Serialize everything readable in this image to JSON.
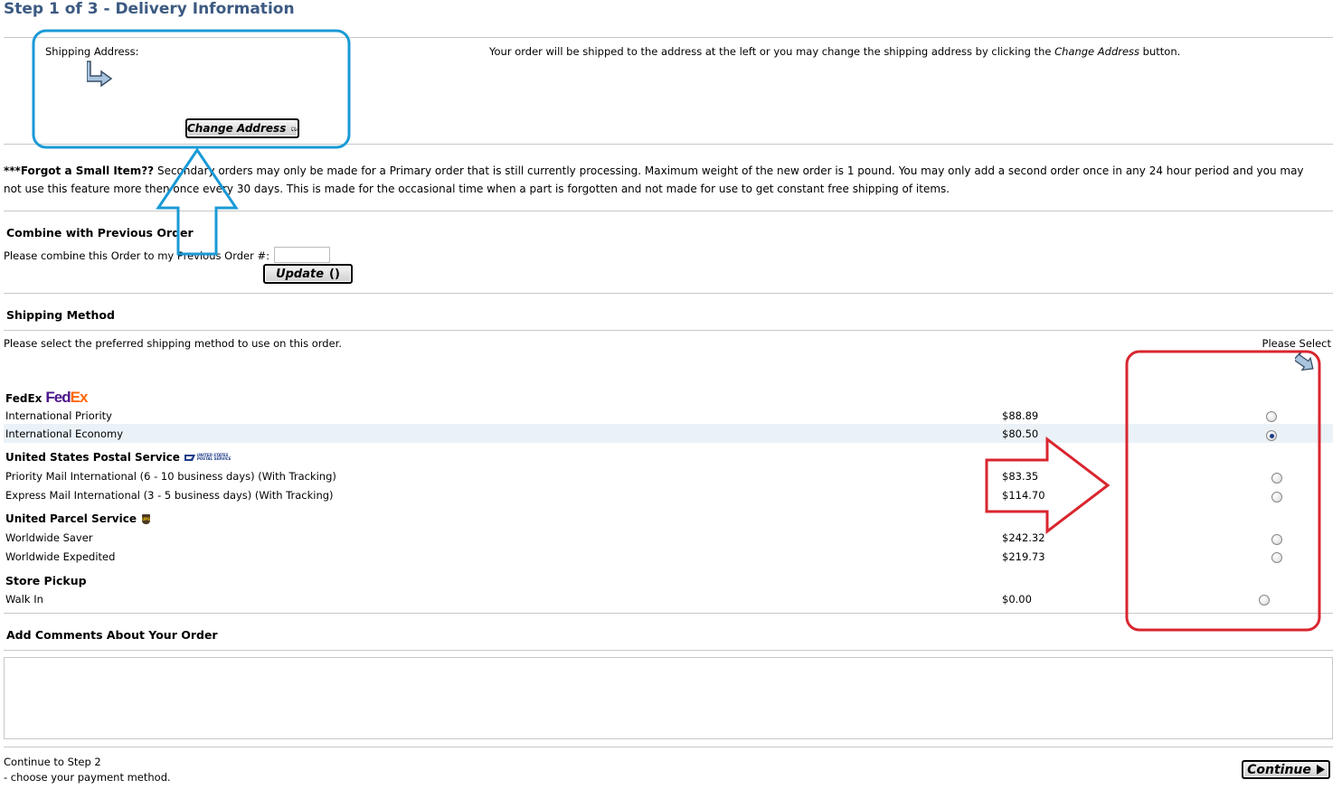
{
  "page": {
    "title": "Step 1 of 3 - Delivery Information"
  },
  "address": {
    "label": "Shipping Address:",
    "change_button": "Change Address",
    "info_pre": "Your order will be shipped to the address at the left or you may change the shipping address by clicking the ",
    "info_em": "Change Address",
    "info_post": " button."
  },
  "notice": {
    "bold": "***Forgot a Small Item??",
    "text": " Secondary orders may only be made for a Primary order that is still currently processing. Maximum weight of the new order is 1 pound. You may only add a second order once in any 24 hour period and you may not use this feature more then once every 30 days. This is made for the occasional time when a part is forgotten and not made for use to get constant free shipping of items."
  },
  "combine": {
    "heading": "Combine with Previous Order",
    "label": "Please combine this Order to my Previous Order #:",
    "input_value": "",
    "update_button": "Update"
  },
  "shipping": {
    "heading": "Shipping Method",
    "instruction": "Please select the preferred shipping method to use on this order.",
    "please_select": "Please Select",
    "carriers": [
      {
        "name": "FedEx",
        "logo_fe": "Fed",
        "logo_ex": "Ex",
        "options": [
          {
            "label": "International Priority",
            "price": "$88.89",
            "selected": false
          },
          {
            "label": "International Economy",
            "price": "$80.50",
            "selected": true
          }
        ]
      },
      {
        "name": "United States Postal Service",
        "logo_text": "UNITED STATES POSTAL SERVICE",
        "options": [
          {
            "label": "Priority Mail International (6 - 10 business days) (With Tracking)",
            "price": "$83.35",
            "selected": false
          },
          {
            "label": "Express Mail International (3 - 5 business days) (With Tracking)",
            "price": "$114.70",
            "selected": false
          }
        ]
      },
      {
        "name": "United Parcel Service",
        "logo_text": "UPS",
        "options": [
          {
            "label": "Worldwide Saver",
            "price": "$242.32",
            "selected": false
          },
          {
            "label": "Worldwide Expedited",
            "price": "$219.73",
            "selected": false
          }
        ]
      },
      {
        "name": "Store Pickup",
        "options": [
          {
            "label": "Walk In",
            "price": "$0.00",
            "selected": false
          }
        ]
      }
    ]
  },
  "comments": {
    "heading": "Add Comments About Your Order",
    "value": ""
  },
  "footer": {
    "line1": "Continue to Step 2",
    "line2": "- choose your payment method.",
    "continue_button": "Continue"
  },
  "annotations": {
    "blue_color": "#1a9ad6",
    "red_color": "#d9262f"
  }
}
